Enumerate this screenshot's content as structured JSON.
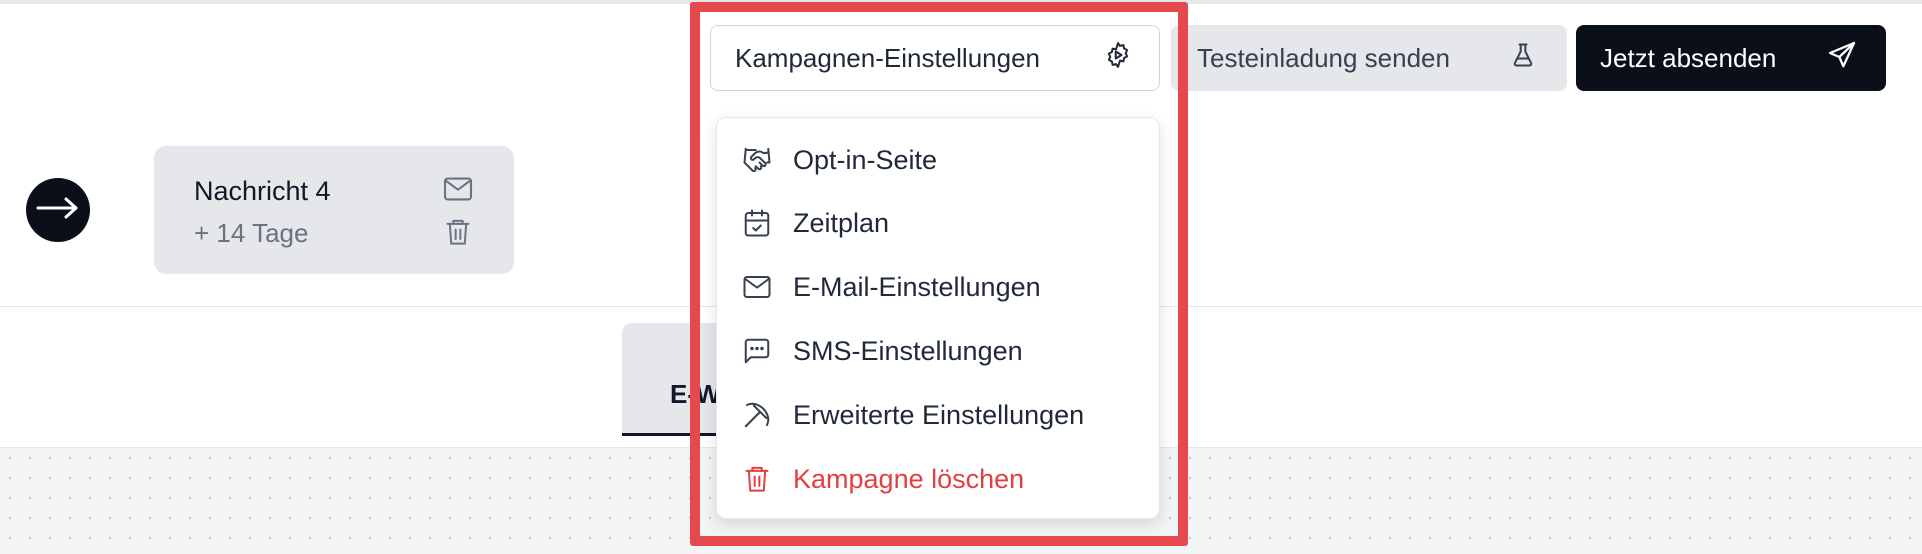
{
  "header": {
    "settings_label": "Kampagnen-Einstellungen",
    "test_label": "Testeinladung senden",
    "send_label": "Jetzt absenden",
    "settings_icon": "gear-play-icon",
    "test_icon": "flask-icon",
    "send_icon": "paper-plane-icon"
  },
  "timeline": {
    "start_icon": "arrow-right-icon",
    "message": {
      "title": "Nachricht 4",
      "delay": "+ 14 Tage",
      "icons": [
        "mail-icon",
        "trash-icon"
      ]
    }
  },
  "tabs": {
    "active_label": "E-W"
  },
  "dropdown": {
    "items": [
      {
        "label": "Opt-in-Seite",
        "icon": "handshake-icon"
      },
      {
        "label": "Zeitplan",
        "icon": "calendar-check-icon"
      },
      {
        "label": "E-Mail-Einstellungen",
        "icon": "mail-icon"
      },
      {
        "label": "SMS-Einstellungen",
        "icon": "chat-bubble-icon"
      },
      {
        "label": "Erweiterte Einstellungen",
        "icon": "pickaxe-icon"
      },
      {
        "label": "Kampagne löschen",
        "icon": "trash-icon",
        "danger": true
      }
    ]
  },
  "colors": {
    "accent_dark": "#0b0f19",
    "danger": "#e53e3e",
    "highlight": "#e5484d",
    "muted_bg": "#e5e7eb"
  }
}
